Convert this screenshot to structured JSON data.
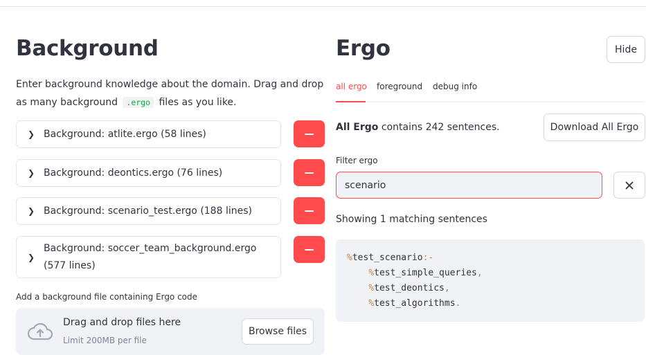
{
  "background": {
    "title": "Background",
    "desc_part1": "Enter background knowledge about the domain. Drag and drop as many background",
    "desc_code": ".ergo",
    "desc_part2": "files as you like.",
    "files": [
      {
        "label": "Background: atlite.ergo (58 lines)"
      },
      {
        "label": "Background: deontics.ergo (76 lines)"
      },
      {
        "label": "Background: scenario_test.ergo (188 lines)"
      },
      {
        "label": "Background: soccer_team_background.ergo (577 lines)"
      }
    ],
    "add_label": "Add a background file containing Ergo code",
    "uploader": {
      "title": "Drag and drop files here",
      "limit": "Limit 200MB per file",
      "browse": "Browse files"
    }
  },
  "ergo": {
    "title": "Ergo",
    "hide_label": "Hide",
    "tabs": [
      {
        "label": "all ergo",
        "active": true
      },
      {
        "label": "foreground",
        "active": false
      },
      {
        "label": "debug info",
        "active": false
      }
    ],
    "count_bold": "All Ergo",
    "count_rest": "contains 242 sentences.",
    "download_label": "Download All Ergo",
    "filter_label": "Filter ergo",
    "filter_value": "scenario",
    "matching": "Showing 1 matching sentences",
    "code": [
      {
        "name": "test_scenario",
        "suffix": ":-",
        "indent": false
      },
      {
        "name": "test_simple_queries",
        "suffix": ",",
        "indent": true
      },
      {
        "name": "test_deontics",
        "suffix": ",",
        "indent": true
      },
      {
        "name": "test_algorithms",
        "suffix": ".",
        "indent": true
      }
    ]
  },
  "colors": {
    "accent": "#ff4b4b",
    "panel": "#f0f2f6",
    "text": "#31333f",
    "code_keyword": "#c9854b"
  },
  "icons": [
    "chevron-right-icon",
    "minus-icon",
    "cloud-upload-icon",
    "close-icon"
  ]
}
